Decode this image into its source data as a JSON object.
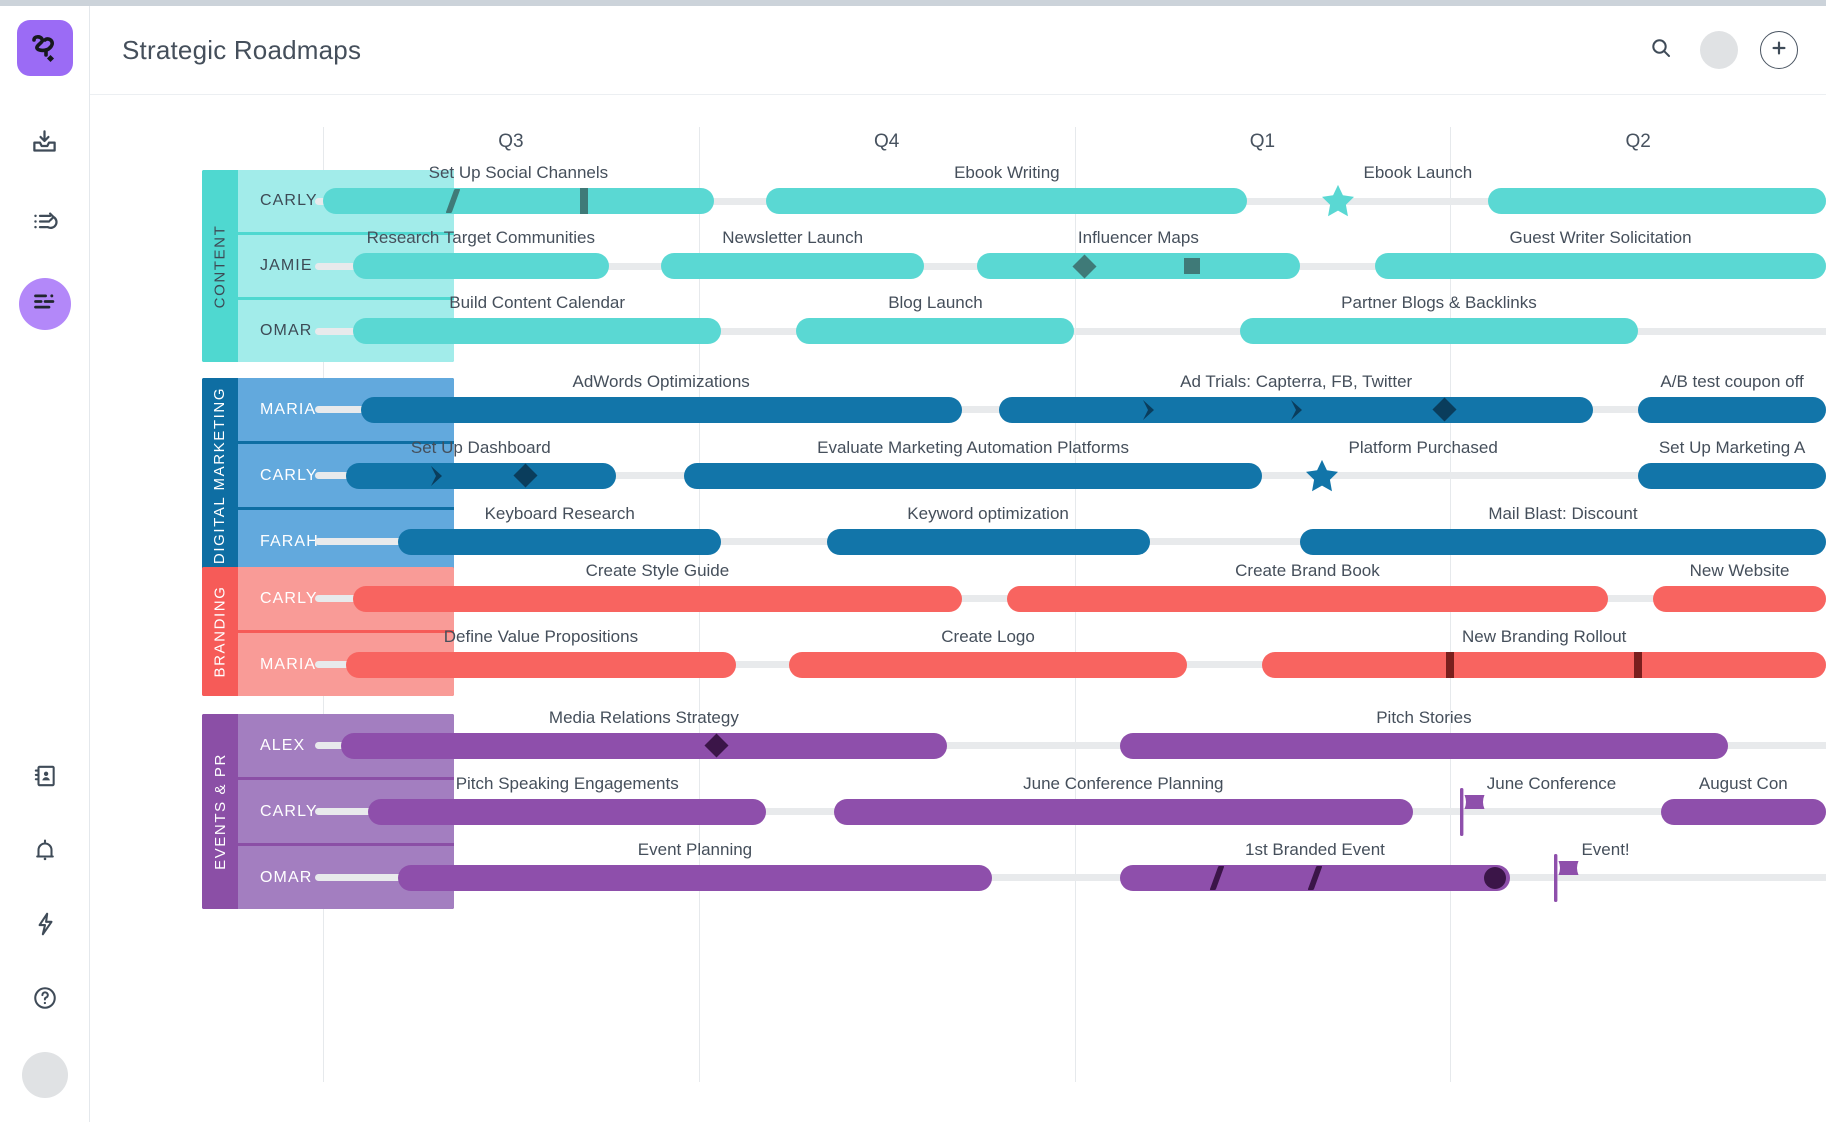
{
  "app": {
    "logo_icon": "roadmunk-logo-icon",
    "title": "Strategic Roadmaps"
  },
  "rail": {
    "items": [
      {
        "icon": "inbox-download-icon",
        "label": "Inbox",
        "active": false
      },
      {
        "icon": "list-reorder-icon",
        "label": "Lists",
        "active": false
      },
      {
        "icon": "roadmap-view-icon",
        "label": "Roadmaps",
        "active": true
      }
    ],
    "bottom_items": [
      {
        "icon": "contacts-book-icon",
        "label": "Contacts"
      },
      {
        "icon": "bell-icon",
        "label": "Notifications"
      },
      {
        "icon": "lightning-icon",
        "label": "Integrations"
      },
      {
        "icon": "help-circle-icon",
        "label": "Help"
      }
    ],
    "avatar": "user-avatar"
  },
  "topbar": {
    "search_icon": "search-icon",
    "avatar_icon": "user-avatar",
    "add_icon": "plus-icon",
    "add_label": "+"
  },
  "timeline": {
    "quarters": [
      "Q3",
      "Q4",
      "Q1",
      "Q2"
    ],
    "colors": {
      "content_spine": "#4fd8d0",
      "content_row": "#a2ecea",
      "content_bar": "#5ad8d3",
      "digital_spine": "#0e6ea3",
      "digital_row": "#62a9dd",
      "digital_bar": "#1275a9",
      "branding_spine": "#f65b58",
      "branding_row": "#f99b97",
      "branding_bar": "#f86460",
      "events_spine": "#8b4fa6",
      "events_row": "#a37ec0",
      "events_bar": "#8e4fab"
    }
  },
  "chart_data": {
    "type": "timeline",
    "title": "Strategic Roadmaps",
    "x_axis": {
      "categories": [
        "Q3",
        "Q4",
        "Q1",
        "Q2"
      ],
      "grid": true
    },
    "groups": [
      {
        "name": "CONTENT",
        "color": "#5ad8d3",
        "rows": [
          {
            "owner": "CARLY",
            "bars": [
              {
                "label": "Set Up Social Channels",
                "start": 0.0,
                "end": 0.26,
                "markers": [
                  "slash",
                  "bar"
                ]
              },
              {
                "label": "Ebook Writing",
                "start": 0.295,
                "end": 0.615,
                "markers": []
              },
              {
                "label": "Ebook Launch",
                "type": "milestone",
                "shape": "star",
                "at": 0.675
              },
              {
                "label": "",
                "start": 0.775,
                "end": 1.0,
                "markers": []
              }
            ]
          },
          {
            "owner": "JAMIE",
            "bars": [
              {
                "label": "Research Target Communities",
                "start": 0.02,
                "end": 0.19,
                "markers": []
              },
              {
                "label": "Newsletter Launch",
                "start": 0.225,
                "end": 0.4,
                "markers": []
              },
              {
                "label": "Influencer Maps",
                "start": 0.435,
                "end": 0.65,
                "markers": [
                  "diamond",
                  "square"
                ]
              },
              {
                "label": "Guest Writer Solicitation",
                "start": 0.7,
                "end": 1.0,
                "markers": []
              }
            ]
          },
          {
            "owner": "OMAR",
            "bars": [
              {
                "label": "Build Content Calendar",
                "start": 0.02,
                "end": 0.265,
                "markers": []
              },
              {
                "label": "Blog Launch",
                "start": 0.315,
                "end": 0.5,
                "markers": []
              },
              {
                "label": "Partner Blogs & Backlinks",
                "start": 0.61,
                "end": 0.875,
                "markers": []
              }
            ]
          }
        ]
      },
      {
        "name": "DIGITAL MARKETING",
        "color": "#1275a9",
        "rows": [
          {
            "owner": "MARIA",
            "bars": [
              {
                "label": "AdWords Optimizations",
                "start": 0.025,
                "end": 0.425,
                "markers": []
              },
              {
                "label": "Ad Trials: Capterra, FB, Twitter",
                "start": 0.45,
                "end": 0.845,
                "markers": [
                  "chevron",
                  "chevron",
                  "diamond"
                ]
              },
              {
                "label": "A/B test coupon off",
                "start": 0.875,
                "end": 1.0,
                "markers": []
              }
            ]
          },
          {
            "owner": "CARLY",
            "bars": [
              {
                "label": "Set Up Dashboard",
                "start": 0.015,
                "end": 0.195,
                "markers": [
                  "chevron",
                  "diamond"
                ]
              },
              {
                "label": "Evaluate Marketing Automation Platforms",
                "start": 0.24,
                "end": 0.625,
                "markers": []
              },
              {
                "label": "Platform Purchased",
                "type": "milestone",
                "shape": "star",
                "at": 0.665
              },
              {
                "label": "Set Up Marketing A",
                "start": 0.875,
                "end": 1.0,
                "markers": []
              }
            ]
          },
          {
            "owner": "FARAH",
            "bars": [
              {
                "label": "Keyboard Research",
                "start": 0.05,
                "end": 0.265,
                "markers": []
              },
              {
                "label": "Keyword optimization",
                "start": 0.335,
                "end": 0.55,
                "markers": []
              },
              {
                "label": "Mail Blast: Discount",
                "start": 0.65,
                "end": 1.0,
                "markers": []
              }
            ]
          }
        ]
      },
      {
        "name": "BRANDING",
        "color": "#f86460",
        "rows": [
          {
            "owner": "CARLY",
            "bars": [
              {
                "label": "Create Style Guide",
                "start": 0.02,
                "end": 0.425,
                "markers": []
              },
              {
                "label": "Create Brand Book",
                "start": 0.455,
                "end": 0.855,
                "markers": []
              },
              {
                "label": "New Website",
                "start": 0.885,
                "end": 1.0,
                "markers": []
              }
            ]
          },
          {
            "owner": "MARIA",
            "bars": [
              {
                "label": "Define Value Propositions",
                "start": 0.015,
                "end": 0.275,
                "markers": []
              },
              {
                "label": "Create Logo",
                "start": 0.31,
                "end": 0.575,
                "markers": []
              },
              {
                "label": "New Branding Rollout",
                "start": 0.625,
                "end": 1.0,
                "markers": [
                  "bar",
                  "bar"
                ]
              }
            ]
          }
        ]
      },
      {
        "name": "EVENTS & PR",
        "color": "#8e4fab",
        "rows": [
          {
            "owner": "ALEX",
            "bars": [
              {
                "label": "Media Relations Strategy",
                "start": 0.012,
                "end": 0.415,
                "markers": [
                  "diamond"
                ]
              },
              {
                "label": "Pitch Stories",
                "start": 0.53,
                "end": 0.935,
                "markers": []
              }
            ]
          },
          {
            "owner": "CARLY",
            "bars": [
              {
                "label": "Pitch Speaking Engagements",
                "start": 0.03,
                "end": 0.295,
                "markers": []
              },
              {
                "label": "June Conference Planning",
                "start": 0.34,
                "end": 0.725,
                "markers": []
              },
              {
                "label": "June Conference",
                "type": "milestone",
                "shape": "flag",
                "at": 0.757
              },
              {
                "label": "August Con",
                "start": 0.89,
                "end": 1.0,
                "markers": []
              }
            ]
          },
          {
            "owner": "OMAR",
            "bars": [
              {
                "label": "Event Planning",
                "start": 0.05,
                "end": 0.445,
                "markers": []
              },
              {
                "label": "1st Branded Event",
                "start": 0.53,
                "end": 0.79,
                "markers": [
                  "slash",
                  "slash",
                  "dot"
                ]
              },
              {
                "label": "Event!",
                "type": "milestone",
                "shape": "flag",
                "at": 0.82
              }
            ]
          }
        ]
      }
    ]
  }
}
